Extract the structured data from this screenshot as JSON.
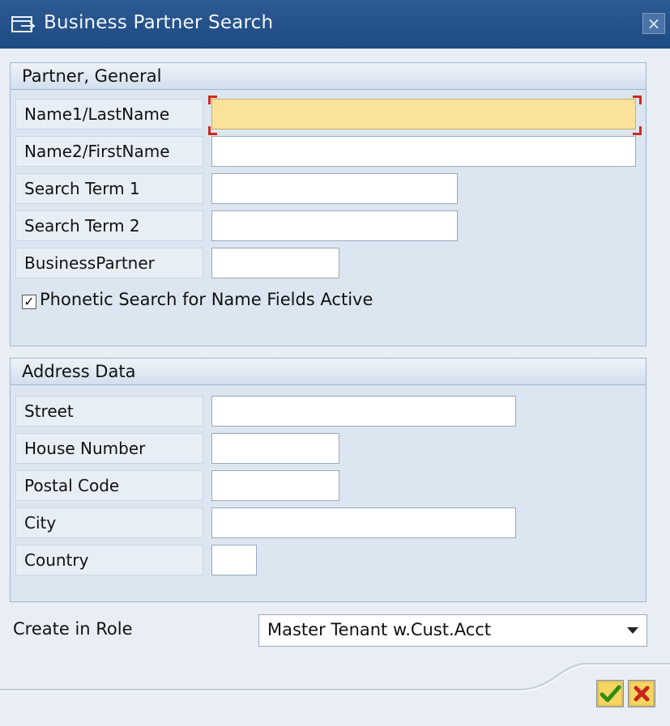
{
  "window": {
    "title": "Business Partner Search",
    "close_glyph": "×"
  },
  "partner_general": {
    "header": "Partner, General",
    "name1_label": "Name1/LastName",
    "name1_value": "",
    "name2_label": "Name2/FirstName",
    "name2_value": "",
    "search_term1_label": "Search Term 1",
    "search_term1_value": "",
    "search_term2_label": "Search Term 2",
    "search_term2_value": "",
    "business_partner_label": "BusinessPartner",
    "business_partner_value": "",
    "phonetic_label": "Phonetic Search for Name Fields Active",
    "phonetic_checked": true,
    "check_glyph": "✓"
  },
  "address_data": {
    "header": "Address Data",
    "street_label": "Street",
    "street_value": "",
    "house_number_label": "House Number",
    "house_number_value": "",
    "postal_code_label": "Postal Code",
    "postal_code_value": "",
    "city_label": "City",
    "city_value": "",
    "country_label": "Country",
    "country_value": ""
  },
  "role": {
    "label": "Create in Role",
    "selected": "Master Tenant w.Cust.Acct"
  },
  "icons": {
    "title": "window-icon",
    "ok": "green-checkmark-icon",
    "cancel": "red-x-icon"
  },
  "colors": {
    "title_bar": "#1d4a82",
    "focused_field": "#fbe29a",
    "ok": "#3a9a1a",
    "cancel": "#c8241a"
  }
}
